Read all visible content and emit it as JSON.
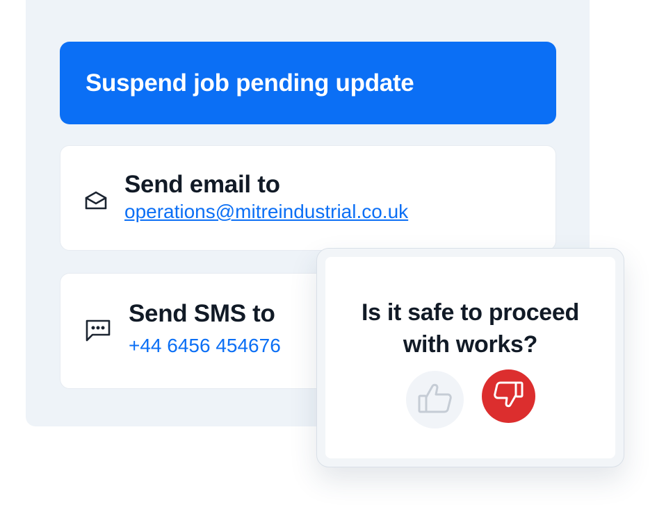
{
  "action": {
    "label": "Suspend job pending update"
  },
  "email_card": {
    "title": "Send email to",
    "address": "operations@mitreindustrial.co.uk",
    "icon": "envelope-open-icon"
  },
  "sms_card": {
    "title": "Send SMS to",
    "phone": "+44 6456 454676",
    "icon": "message-dots-icon"
  },
  "popup": {
    "question_line1": "Is it safe to proceed",
    "question_line2": "with works?",
    "thumbs_up_icon": "thumbs-up-icon",
    "thumbs_down_icon": "thumbs-down-icon",
    "selected": "thumbs-down"
  },
  "colors": {
    "accent": "#0b6ff5",
    "panel": "#eef3f8",
    "danger": "#dc2e2e",
    "text": "#111a26"
  }
}
